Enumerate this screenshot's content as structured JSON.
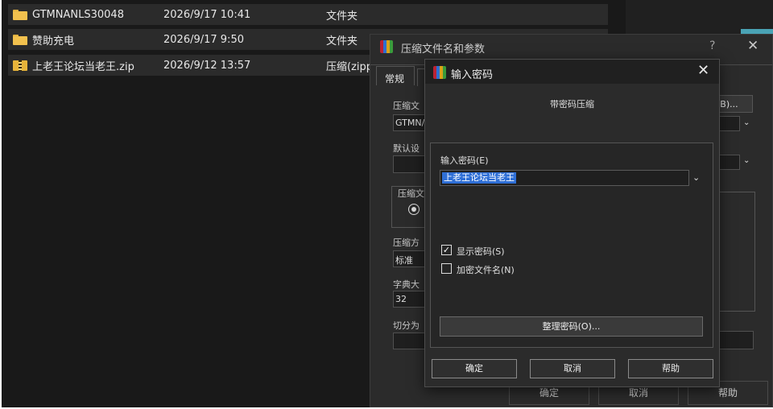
{
  "explorer": {
    "files": [
      {
        "name": "GTMNANLS30048",
        "date": "2026/9/17 10:41",
        "type": "文件夹",
        "icon": "folder-icon"
      },
      {
        "name": "赞助充电",
        "date": "2026/9/17 9:50",
        "type": "文件夹",
        "icon": "folder-icon"
      },
      {
        "name": "上老王论坛当老王.zip",
        "date": "2026/9/12 13:57",
        "type": "压缩(zipp",
        "icon": "zip-icon"
      }
    ]
  },
  "bg_dialog": {
    "title": "压缩文件名和参数",
    "help_mark": "?",
    "close": "✕",
    "tab_general": "常规",
    "archive_name_label": "压缩文",
    "archive_name_value": "GTMN/",
    "default_profile_label": "默认设",
    "format_group_label": "压缩文",
    "method_label": "压缩方",
    "method_value": "标准",
    "dict_label": "字典大",
    "dict_value": "32",
    "split_label": "切分为",
    "browse_label": "(B)...",
    "ok": "确定",
    "cancel": "取消",
    "help": "帮助"
  },
  "pw_dialog": {
    "title": "输入密码",
    "close": "✕",
    "heading": "带密码压缩",
    "password_label": "输入密码(E)",
    "password_value": "上老王论坛当老王",
    "show_password": "显示密码(S)",
    "show_password_checked": true,
    "encrypt_names": "加密文件名(N)",
    "encrypt_names_checked": false,
    "organize_button": "整理密码(O)...",
    "ok": "确定",
    "cancel": "取消",
    "help": "帮助"
  },
  "colors": {
    "selection": "#2f6fd6",
    "folder": "#f2c14e"
  }
}
